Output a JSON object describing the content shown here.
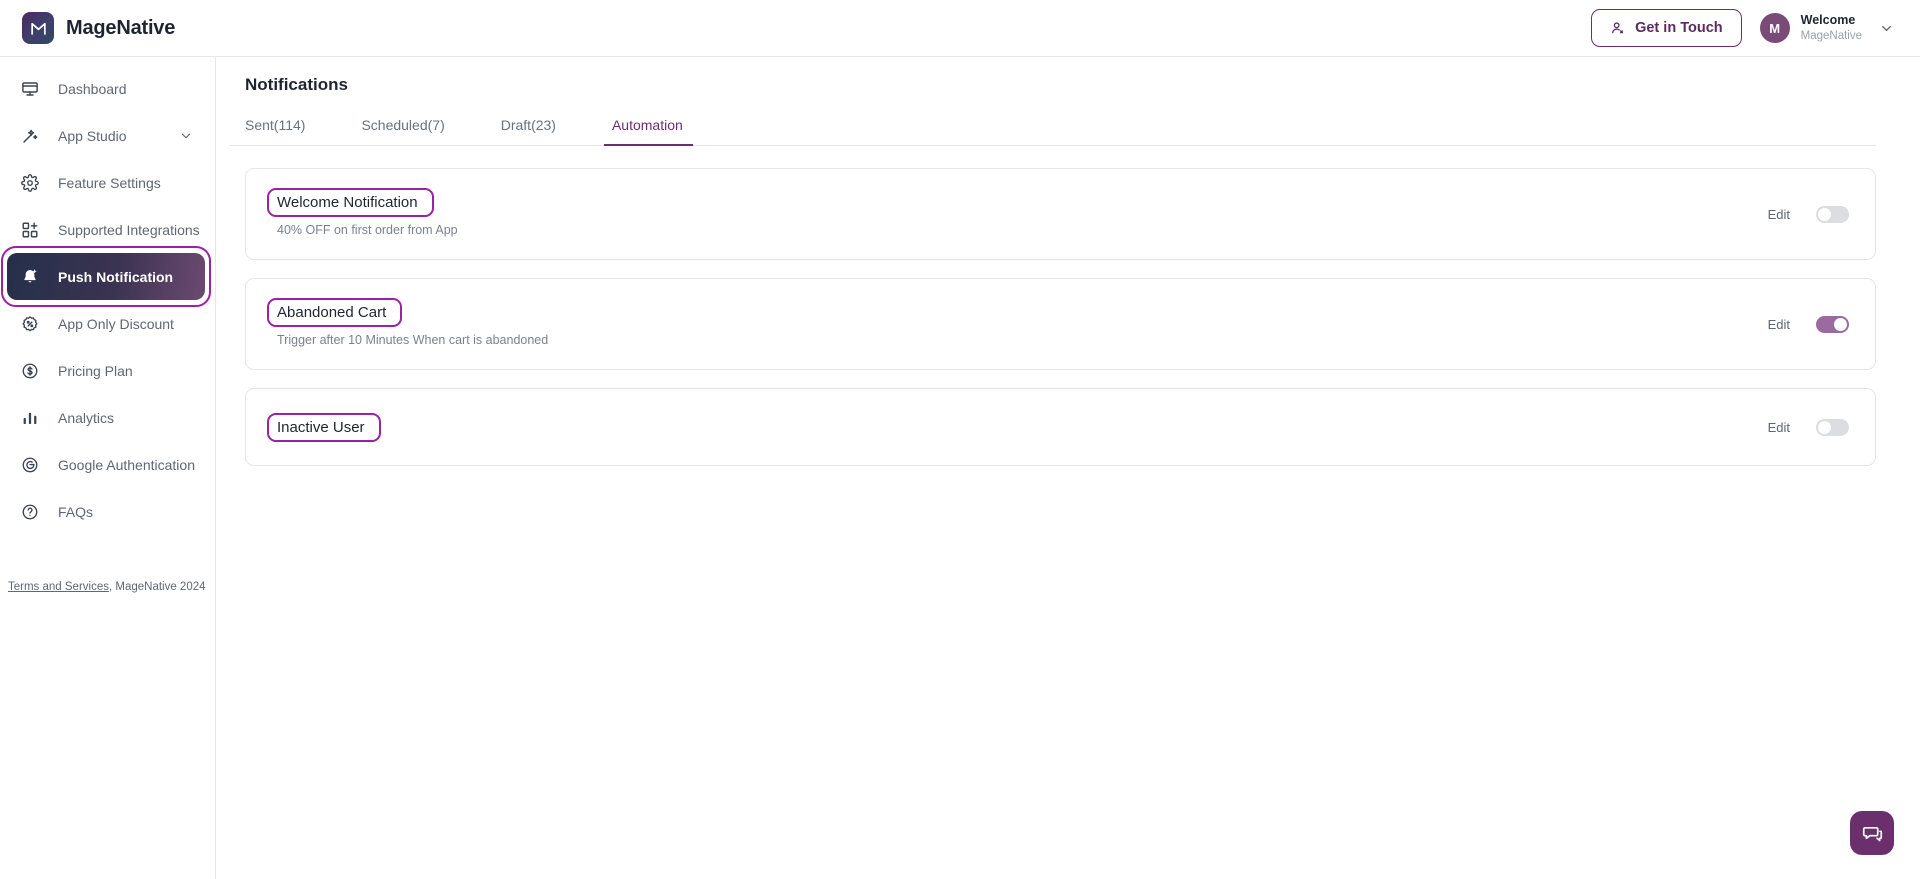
{
  "brand": {
    "name": "MageNative",
    "logo_letter": "M",
    "logo_icon": "magenative-logo-icon"
  },
  "header": {
    "get_in_touch": "Get in Touch",
    "user": {
      "avatar_letter": "M",
      "greeting": "Welcome",
      "org": "MageNative"
    }
  },
  "sidebar": {
    "items": [
      {
        "label": "Dashboard",
        "icon": "monitor-icon",
        "active": false,
        "caret": false
      },
      {
        "label": "App Studio",
        "icon": "magic-wand-icon",
        "active": false,
        "caret": true
      },
      {
        "label": "Feature Settings",
        "icon": "gear-icon",
        "active": false,
        "caret": false
      },
      {
        "label": "Supported Integrations",
        "icon": "grid-plus-icon",
        "active": false,
        "caret": false
      },
      {
        "label": "Push Notification",
        "icon": "bell-plus-icon",
        "active": true,
        "caret": false
      },
      {
        "label": "App Only Discount",
        "icon": "discount-badge-icon",
        "active": false,
        "caret": false
      },
      {
        "label": "Pricing Plan",
        "icon": "dollar-circle-icon",
        "active": false,
        "caret": false
      },
      {
        "label": "Analytics",
        "icon": "bar-chart-icon",
        "active": false,
        "caret": false
      },
      {
        "label": "Google Authentication",
        "icon": "google-icon",
        "active": false,
        "caret": false
      },
      {
        "label": "FAQs",
        "icon": "question-circle-icon",
        "active": false,
        "caret": false
      }
    ],
    "footer_link": "Terms and Services",
    "footer_rest": ", MageNative 2024"
  },
  "main": {
    "title": "Notifications",
    "tabs": [
      {
        "label": "Sent(114)",
        "active": false
      },
      {
        "label": "Scheduled(7)",
        "active": false
      },
      {
        "label": "Draft(23)",
        "active": false
      },
      {
        "label": "Automation",
        "active": true
      }
    ],
    "edit_label": "Edit",
    "cards": [
      {
        "title": "Welcome Notification",
        "subtitle": "40% OFF on first order from App",
        "edit": "Edit",
        "enabled": false
      },
      {
        "title": "Abandoned Cart",
        "subtitle": "Trigger after 10 Minutes When cart is abandoned",
        "edit": "Edit",
        "enabled": true
      },
      {
        "title": "Inactive User",
        "subtitle": "",
        "edit": "Edit",
        "enabled": false
      }
    ]
  },
  "fab": {
    "icon": "chat-bubble-icon"
  },
  "colors": {
    "accent": "#6b2f6e",
    "annotation": "#9b21a8",
    "toggle_on": "#9b6aa0",
    "toggle_off": "#dcdde1"
  }
}
